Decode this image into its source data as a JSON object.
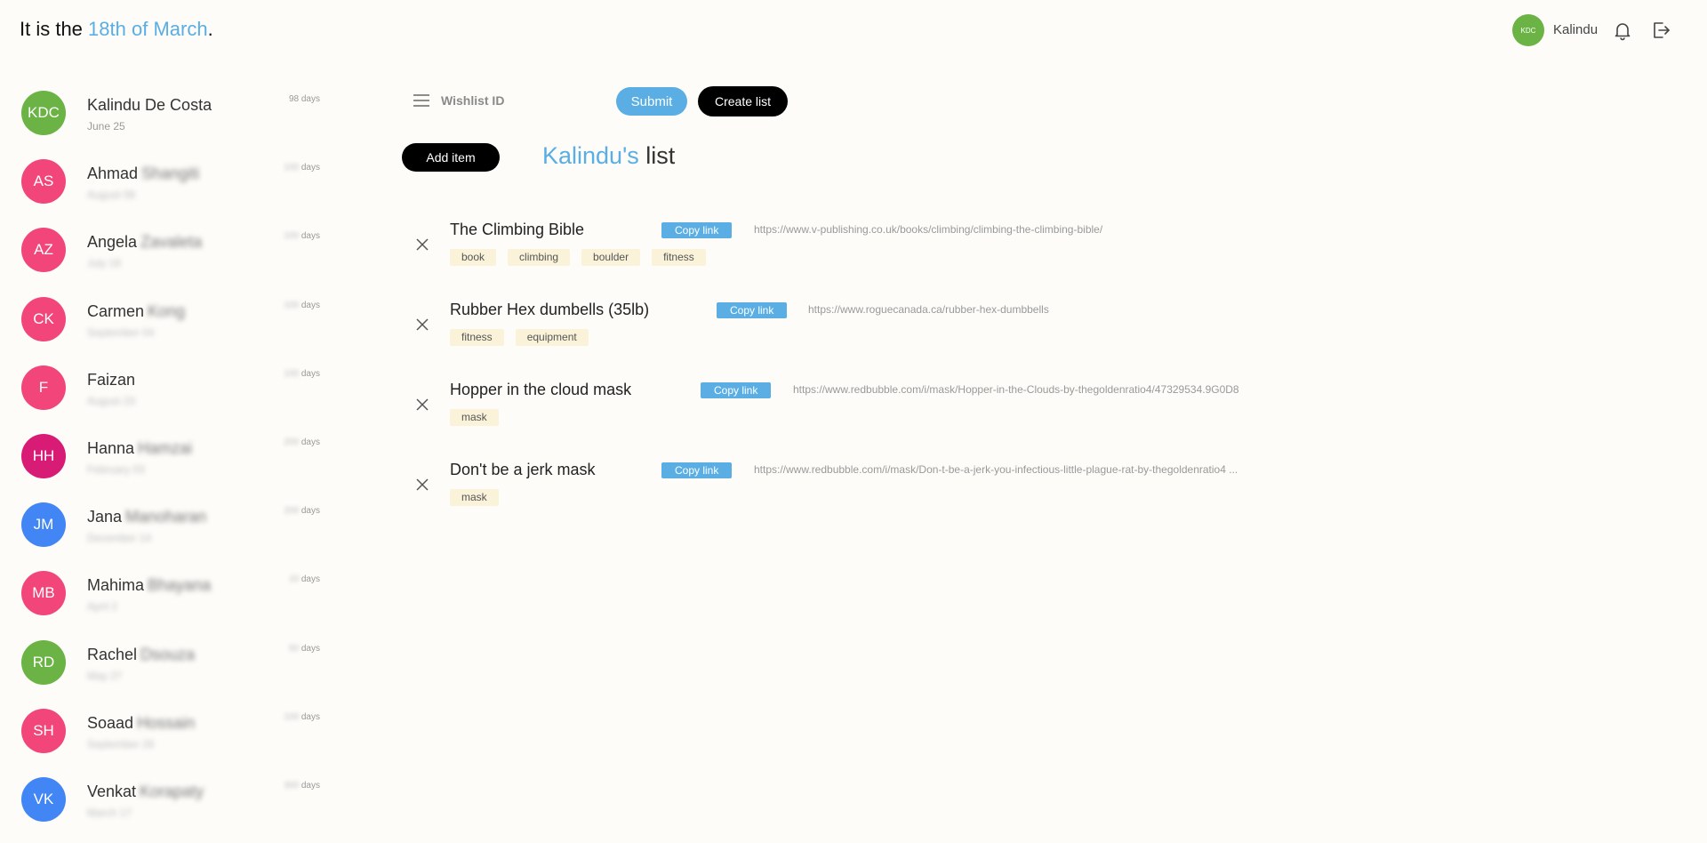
{
  "header": {
    "date_prefix": "It is the ",
    "date_highlight": "18th of March",
    "date_suffix": ".",
    "user_initials": "KDC",
    "user_name": "Kalindu"
  },
  "sidebar": {
    "contacts": [
      {
        "initials": "KDC",
        "first": "Kalindu De Costa",
        "last": "",
        "sub": "June 25",
        "days_num": "98",
        "days_label": "days",
        "color": "#6ab344",
        "redacted": false
      },
      {
        "initials": "AS",
        "first": "Ahmad",
        "last": "Shangiti",
        "sub": "August 08",
        "days_num": "100",
        "days_label": "days",
        "color": "#f2467a",
        "redacted": true
      },
      {
        "initials": "AZ",
        "first": "Angela",
        "last": "Zavaleta",
        "sub": "July 16",
        "days_num": "100",
        "days_label": "days",
        "color": "#f2467a",
        "redacted": true
      },
      {
        "initials": "CK",
        "first": "Carmen",
        "last": "Kong",
        "sub": "September 04",
        "days_num": "100",
        "days_label": "days",
        "color": "#f2467a",
        "redacted": true
      },
      {
        "initials": "F",
        "first": "Faizan",
        "last": "",
        "sub": "August 23",
        "days_num": "100",
        "days_label": "days",
        "color": "#f2467a",
        "redacted": true
      },
      {
        "initials": "HH",
        "first": "Hanna",
        "last": "Hamzai",
        "sub": "February 03",
        "days_num": "200",
        "days_label": "days",
        "color": "#d81b75",
        "redacted": true
      },
      {
        "initials": "JM",
        "first": "Jana",
        "last": "Manoharan",
        "sub": "December 14",
        "days_num": "200",
        "days_label": "days",
        "color": "#4285f4",
        "redacted": true
      },
      {
        "initials": "MB",
        "first": "Mahima",
        "last": "Bhayana",
        "sub": "April 2",
        "days_num": "10",
        "days_label": "days",
        "color": "#f2467a",
        "redacted": true
      },
      {
        "initials": "RD",
        "first": "Rachel",
        "last": "Dsouza",
        "sub": "May 27",
        "days_num": "50",
        "days_label": "days",
        "color": "#6ab344",
        "redacted": true
      },
      {
        "initials": "SH",
        "first": "Soaad",
        "last": "Hossain",
        "sub": "September 26",
        "days_num": "100",
        "days_label": "days",
        "color": "#f2467a",
        "redacted": true
      },
      {
        "initials": "VK",
        "first": "Venkat",
        "last": "Korapaty",
        "sub": "March 17",
        "days_num": "300",
        "days_label": "days",
        "color": "#4285f4",
        "redacted": true
      }
    ]
  },
  "toolbar": {
    "wishlist_placeholder": "Wishlist ID",
    "submit_label": "Submit",
    "create_label": "Create list"
  },
  "list": {
    "add_label": "Add item",
    "owner": "Kalindu's",
    "title_suffix": " list",
    "copy_label": "Copy link",
    "items": [
      {
        "title": "The Climbing Bible",
        "url": "https://www.v-publishing.co.uk/books/climbing/climbing-the-climbing-bible/",
        "tags": [
          "book",
          "climbing",
          "boulder",
          "fitness"
        ]
      },
      {
        "title": "Rubber Hex dumbells (35lb)",
        "url": "https://www.roguecanada.ca/rubber-hex-dumbbells",
        "tags": [
          "fitness",
          "equipment"
        ]
      },
      {
        "title": "Hopper in the cloud mask",
        "url": "https://www.redbubble.com/i/mask/Hopper-in-the-Clouds-by-thegoldenratio4/47329534.9G0D8",
        "tags": [
          "mask"
        ]
      },
      {
        "title": "Don't be a jerk mask",
        "url": "https://www.redbubble.com/i/mask/Don-t-be-a-jerk-you-infectious-little-plague-rat-by-thegoldenratio4 ...",
        "tags": [
          "mask"
        ]
      }
    ]
  },
  "icons": {
    "bell": "bell-icon",
    "logout": "logout-icon",
    "menu": "menu-icon",
    "remove": "close-icon"
  },
  "colors": {
    "accent": "#5aaee3",
    "tag_bg": "#faf3d9",
    "background": "#fdfcf9"
  }
}
